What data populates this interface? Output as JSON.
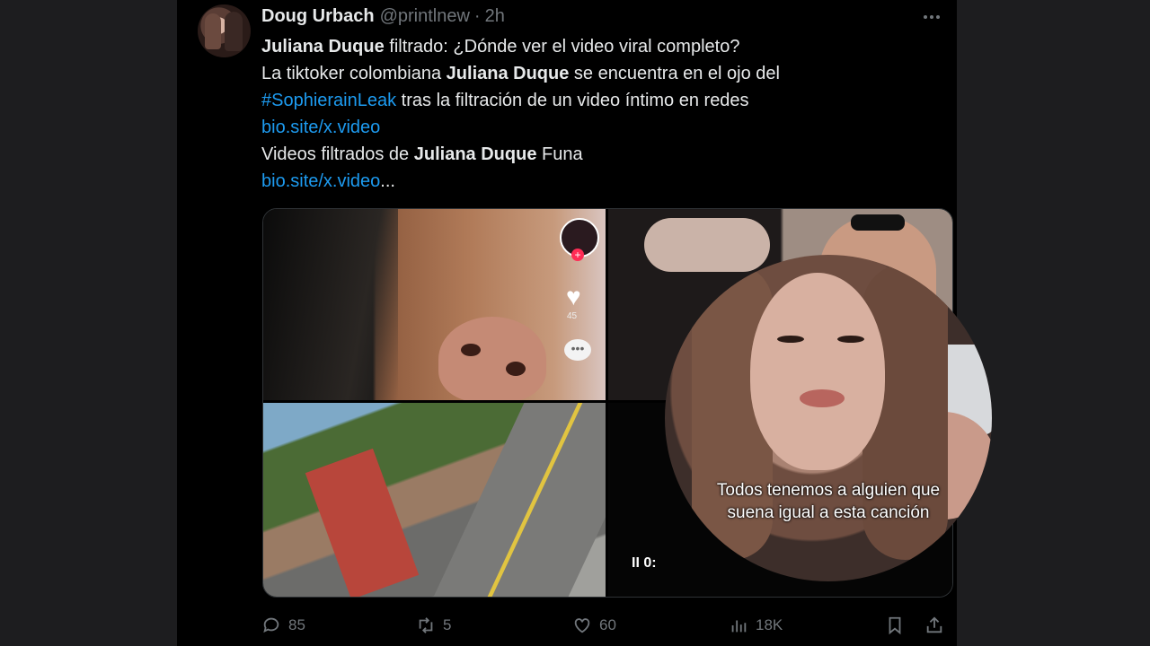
{
  "tweet": {
    "author_name": "Doug Urbach",
    "handle": "@printlnew",
    "separator": "·",
    "time": "2h",
    "lines": {
      "l1_bold": "Juliana Duque",
      "l1_rest": " filtrado: ¿Dónde ver el video viral completo?",
      "l2_pre": "La tiktoker colombiana ",
      "l2_bold": "Juliana Duque",
      "l2_post": " se encuentra en el ojo del",
      "l3_hashtag": "#SophierainLeak",
      "l3_post": " tras la filtración de un video íntimo en redes",
      "l4_link": "bio.site/x.video",
      "l5_pre": "Videos filtrados de ",
      "l5_bold": "Juliana Duque",
      "l5_post": " Funa",
      "l6_link": "bio.site/x.video",
      "l6_ellipsis": "..."
    }
  },
  "media": {
    "tiktok_like_count": "45",
    "tiktok_plus": "+",
    "video_pause_label": "II 0:",
    "overlay_caption_line1": "Todos tenemos a alguien que",
    "overlay_caption_line2": "suena igual a esta canción"
  },
  "actions": {
    "replies": "85",
    "reposts": "5",
    "likes": "60",
    "views": "18K"
  },
  "colors": {
    "background": "#000000",
    "text": "#e7e9ea",
    "muted": "#71767b",
    "link": "#1d9bf0"
  },
  "icons": [
    "more-icon",
    "reply-icon",
    "repost-icon",
    "like-icon",
    "views-icon",
    "bookmark-icon",
    "share-icon"
  ]
}
